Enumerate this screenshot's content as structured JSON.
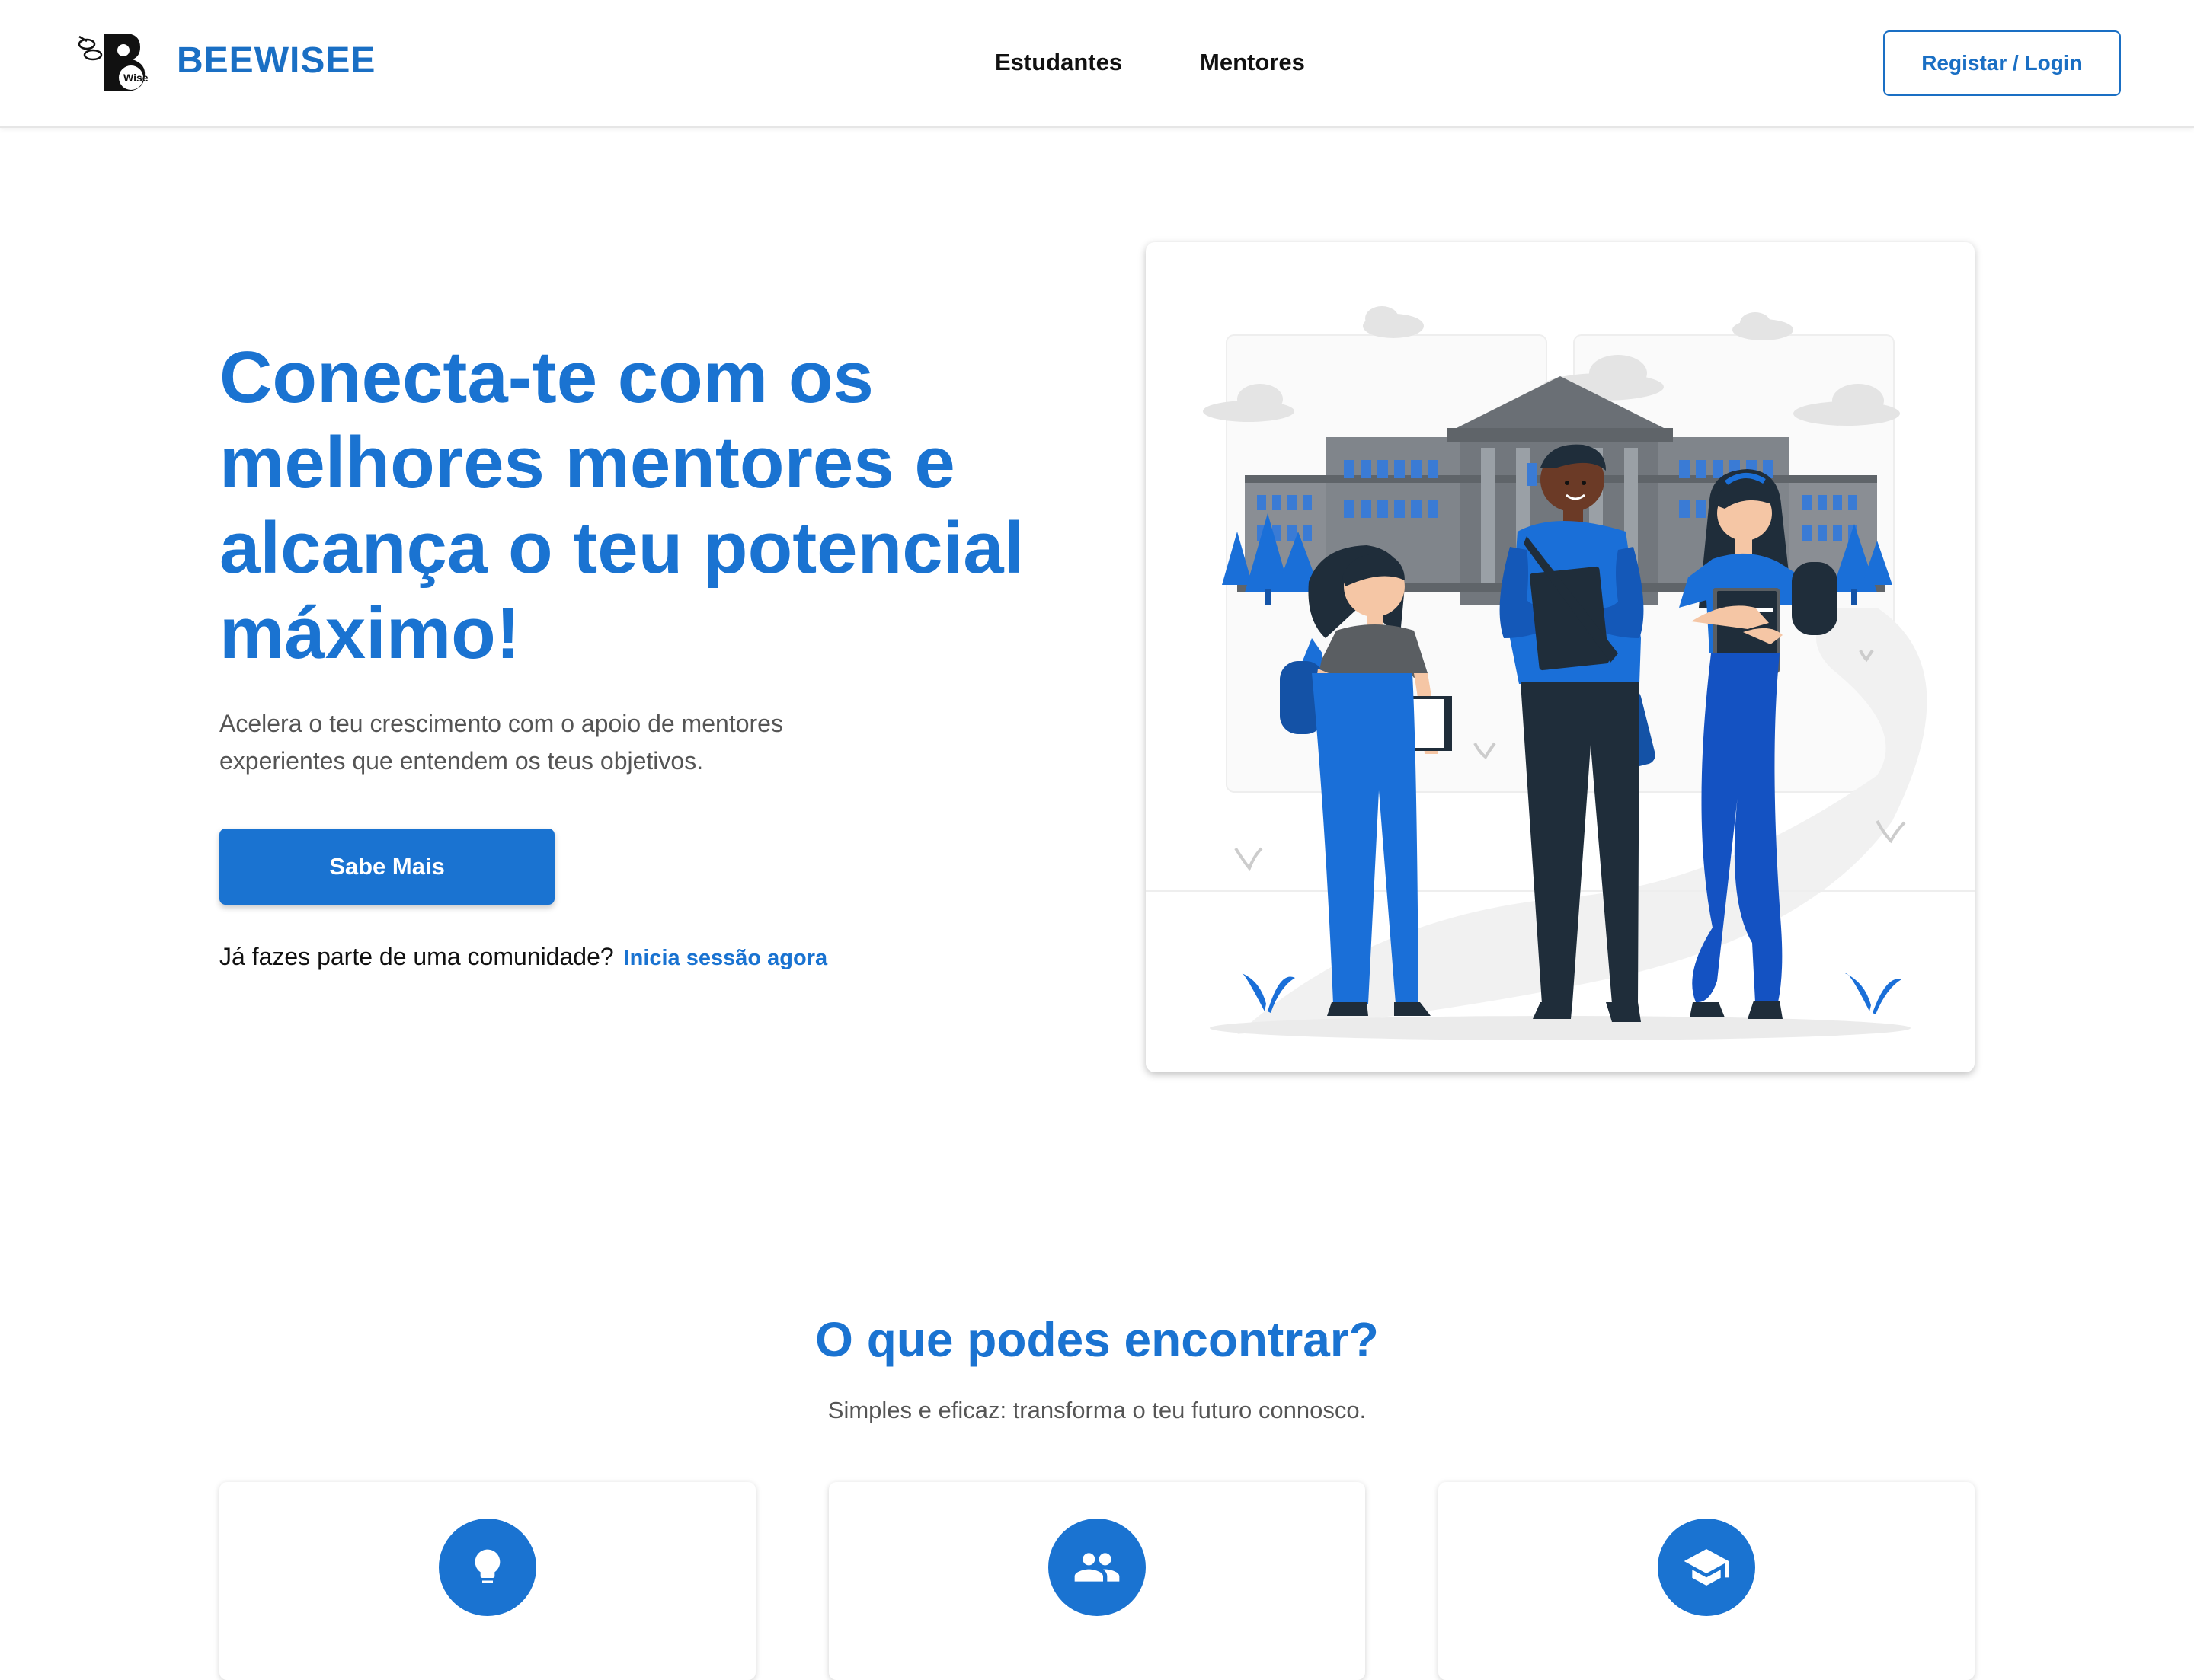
{
  "header": {
    "brand": "BEEWISEE",
    "logo_text": "Wise",
    "nav": [
      {
        "label": "Estudantes"
      },
      {
        "label": "Mentores"
      }
    ],
    "login_label": "Registar / Login"
  },
  "hero": {
    "title": "Conecta-te com os melhores mentores e alcança o teu potencial máximo!",
    "subtitle": "Acelera o teu crescimento com o apoio de mentores experientes que entendem os teus objetivos.",
    "cta_label": "Sabe Mais",
    "signin_prompt": "Já fazes parte de uma comunidade?",
    "signin_link": "Inicia sessão agora"
  },
  "features": {
    "title": "O que podes encontrar?",
    "subtitle": "Simples e eficaz: transforma o teu futuro connosco.",
    "cards": [
      {
        "icon": "lightbulb-icon"
      },
      {
        "icon": "people-icon"
      },
      {
        "icon": "graduation-cap-icon"
      }
    ]
  },
  "colors": {
    "accent": "#1a73d1",
    "brand": "#1a6fc4",
    "text_muted": "#555555"
  }
}
